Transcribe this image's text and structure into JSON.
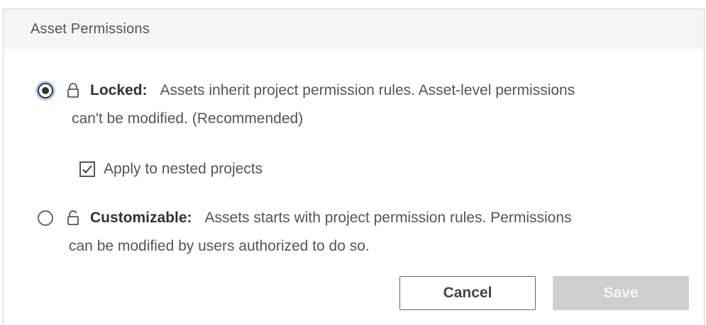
{
  "dialog": {
    "title": "Asset Permissions",
    "options": {
      "locked": {
        "title": "Locked:",
        "desc_line1": "Assets inherit project permission rules. Asset-level permissions",
        "desc_line2": "can't be modified. (Recommended)",
        "selected": true,
        "icon": "lock-icon"
      },
      "customizable": {
        "title": "Customizable:",
        "desc_line1": "Assets starts with project permission rules. Permissions",
        "desc_line2": "can be modified by users authorized to do so.",
        "selected": false,
        "icon": "unlock-icon"
      }
    },
    "nested": {
      "label": "Apply to nested projects",
      "checked": true
    },
    "buttons": {
      "cancel": "Cancel",
      "save": "Save"
    },
    "colors": {
      "accent_focus": "#6eaae6",
      "save_disabled_bg": "#cfcfcf",
      "header_bg": "#f5f5f5"
    }
  }
}
